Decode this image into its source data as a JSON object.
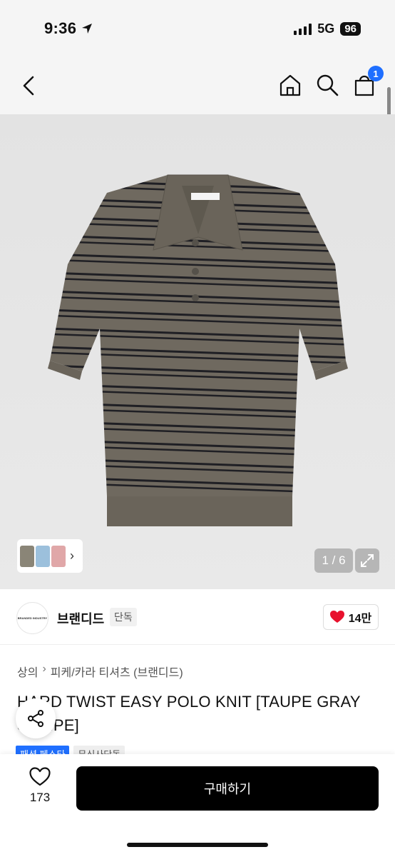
{
  "status_bar": {
    "time": "9:36",
    "network": "5G",
    "battery": "96"
  },
  "nav": {
    "cart_count": "1",
    "icons": [
      "back-chevron-icon",
      "home-icon",
      "search-icon",
      "cart-icon"
    ]
  },
  "hero": {
    "image_counter": "1 / 6",
    "product_image": "striped-polo-knit",
    "shirt_color": "#6f695f",
    "stripe_color": "#1f1f24",
    "thumbnail_colors": [
      "#8a8577",
      "#9cc0dc",
      "#e0a7a8"
    ]
  },
  "brand": {
    "name": "브랜디드",
    "tag": "단독",
    "likes": "14만",
    "logo_text": "BRANDED INDUSTRY"
  },
  "breadcrumb": [
    "상의",
    "피케/카라 티셔츠 (브랜디드)"
  ],
  "product": {
    "title": "HARD TWIST EASY POLO KNIT [TAUPE GRAY STRIPE]",
    "tags": [
      "패션 페스타",
      "무신사단독"
    ]
  },
  "bottom": {
    "wish_count": "173",
    "buy_label": "구매하기"
  },
  "colors": {
    "accent_blue": "#1f6fff",
    "heart_red": "#e8112d"
  }
}
